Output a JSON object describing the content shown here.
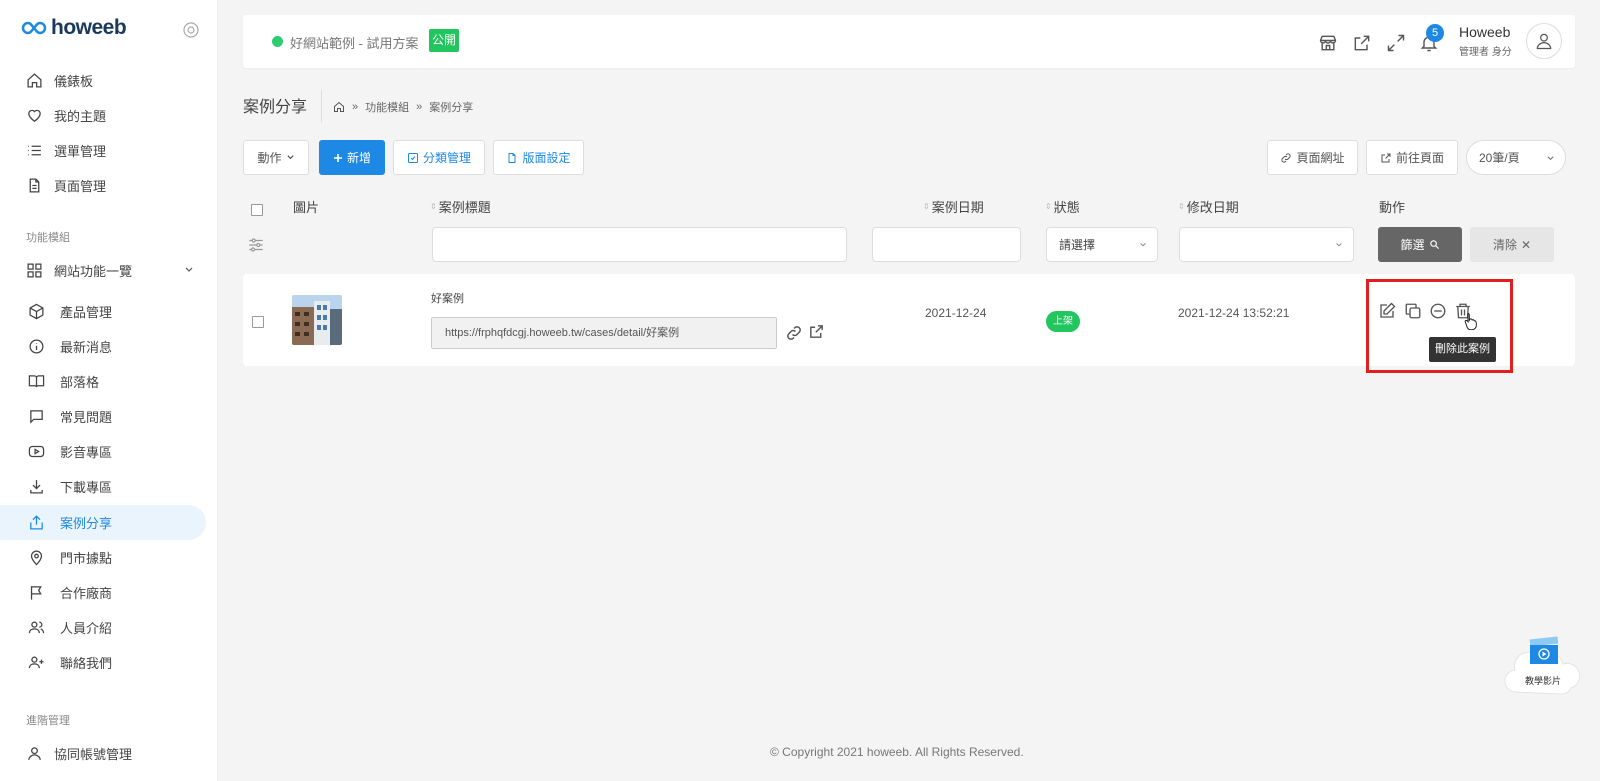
{
  "brand": {
    "logo_text": "howeeb"
  },
  "sidebar": {
    "items_top": [
      {
        "label": "儀錶板",
        "icon": "home-icon"
      },
      {
        "label": "我的主題",
        "icon": "heart-icon"
      },
      {
        "label": "選單管理",
        "icon": "list-icon"
      },
      {
        "label": "頁面管理",
        "icon": "document-icon"
      }
    ],
    "section_modules": "功能模組",
    "group_label": "網站功能一覽",
    "items_modules": [
      {
        "label": "產品管理",
        "icon": "box-icon"
      },
      {
        "label": "最新消息",
        "icon": "info-icon"
      },
      {
        "label": "部落格",
        "icon": "book-icon"
      },
      {
        "label": "常見問題",
        "icon": "chat-icon"
      },
      {
        "label": "影音專區",
        "icon": "video-icon"
      },
      {
        "label": "下載專區",
        "icon": "download-icon"
      },
      {
        "label": "案例分享",
        "icon": "share-icon",
        "active": true
      },
      {
        "label": "門市據點",
        "icon": "map-pin-icon"
      },
      {
        "label": "合作廠商",
        "icon": "flag-icon"
      },
      {
        "label": "人員介紹",
        "icon": "users-icon"
      },
      {
        "label": "聯絡我們",
        "icon": "user-plus-icon"
      }
    ],
    "section_advanced": "進階管理",
    "item_account": "協同帳號管理"
  },
  "topbar": {
    "site_name": "好網站範例 - 試用方案",
    "public_badge": "公開",
    "notification_count": "5",
    "user_name": "Howeeb",
    "user_role": "管理者 身分"
  },
  "page": {
    "title": "案例分享",
    "breadcrumb": [
      "功能模組",
      "案例分享"
    ]
  },
  "toolbar": {
    "action_label": "動作",
    "add_label": "新增",
    "category_label": "分類管理",
    "layout_label": "版面設定",
    "page_url_label": "頁面網址",
    "goto_page_label": "前往頁面",
    "per_page": "20筆/頁"
  },
  "table": {
    "headers": {
      "image": "圖片",
      "title": "案例標題",
      "date": "案例日期",
      "status": "狀態",
      "modified": "修改日期",
      "actions": "動作"
    },
    "filters": {
      "status_placeholder": "請選擇",
      "filter_button": "篩選",
      "clear_button": "清除"
    },
    "rows": [
      {
        "title": "好案例",
        "url": "https://frphqfdcgj.howeeb.tw/cases/detail/好案例",
        "date": "2021-12-24",
        "status": "上架",
        "modified": "2021-12-24 13:52:21"
      }
    ],
    "tooltip": "刪除此案例"
  },
  "footer": {
    "copyright": "© Copyright 2021 howeeb. All Rights Reserved."
  },
  "tutorial": {
    "label": "教學影片"
  },
  "colors": {
    "primary": "#1e88e5",
    "success": "#22c55e",
    "highlight": "#e02020"
  }
}
